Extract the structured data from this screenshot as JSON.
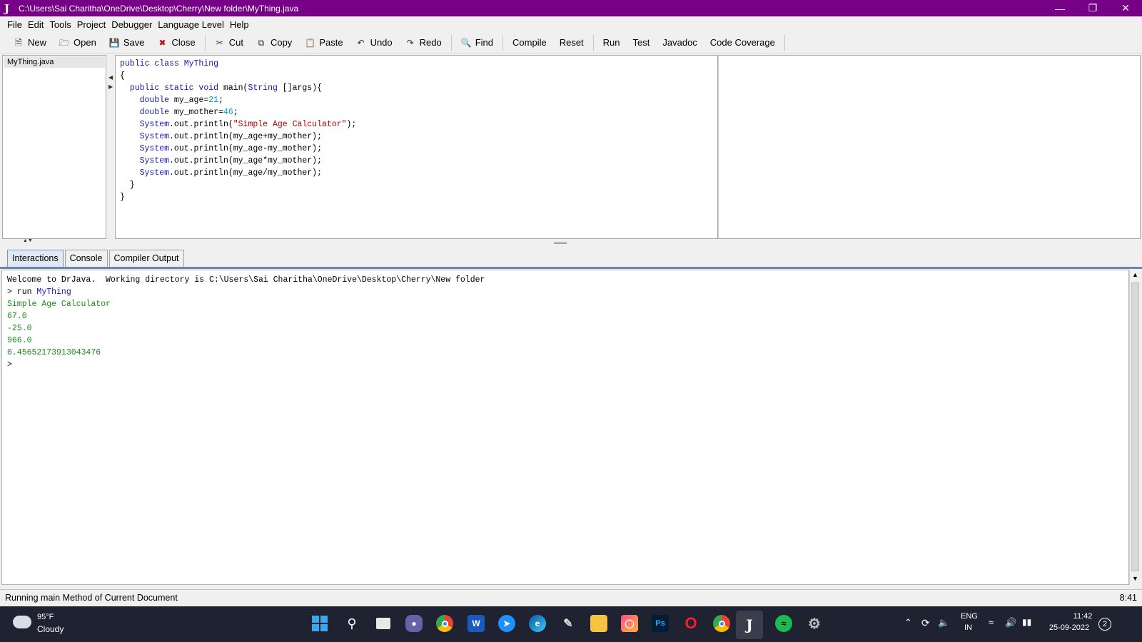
{
  "window": {
    "title": "C:\\Users\\Sai Charitha\\OneDrive\\Desktop\\Cherry\\New folder\\MyThing.java",
    "icon": "J"
  },
  "menu": [
    "File",
    "Edit",
    "Tools",
    "Project",
    "Debugger",
    "Language Level",
    "Help"
  ],
  "toolbar": {
    "new": "New",
    "open": "Open",
    "save": "Save",
    "close": "Close",
    "cut": "Cut",
    "copy": "Copy",
    "paste": "Paste",
    "undo": "Undo",
    "redo": "Redo",
    "find": "Find",
    "compile": "Compile",
    "reset": "Reset",
    "run": "Run",
    "test": "Test",
    "javadoc": "Javadoc",
    "coverage": "Code Coverage"
  },
  "documents": [
    "MyThing.java"
  ],
  "tabs": {
    "interactions": "Interactions",
    "console": "Console",
    "compiler": "Compiler Output"
  },
  "interactions": {
    "welcome": "Welcome to DrJava.  Working directory is C:\\Users\\Sai Charitha\\OneDrive\\Desktop\\Cherry\\New folder",
    "cmd_prompt": "> run ",
    "cmd_class": "MyThing",
    "output": [
      "Simple Age Calculator",
      "67.0",
      "-25.0",
      "966.0",
      "0.45652173913043476"
    ],
    "prompt": ">"
  },
  "status": {
    "message": "Running main Method of Current Document",
    "position": "8:41"
  },
  "taskbar": {
    "weather_temp": "95°F",
    "weather_desc": "Cloudy",
    "lang_top": "ENG",
    "lang_bottom": "IN",
    "time": "11:42",
    "date": "25-09-2022",
    "notifications": "2"
  },
  "colors": {
    "titlebar": "#760086",
    "taskbar": "#1f2230"
  }
}
